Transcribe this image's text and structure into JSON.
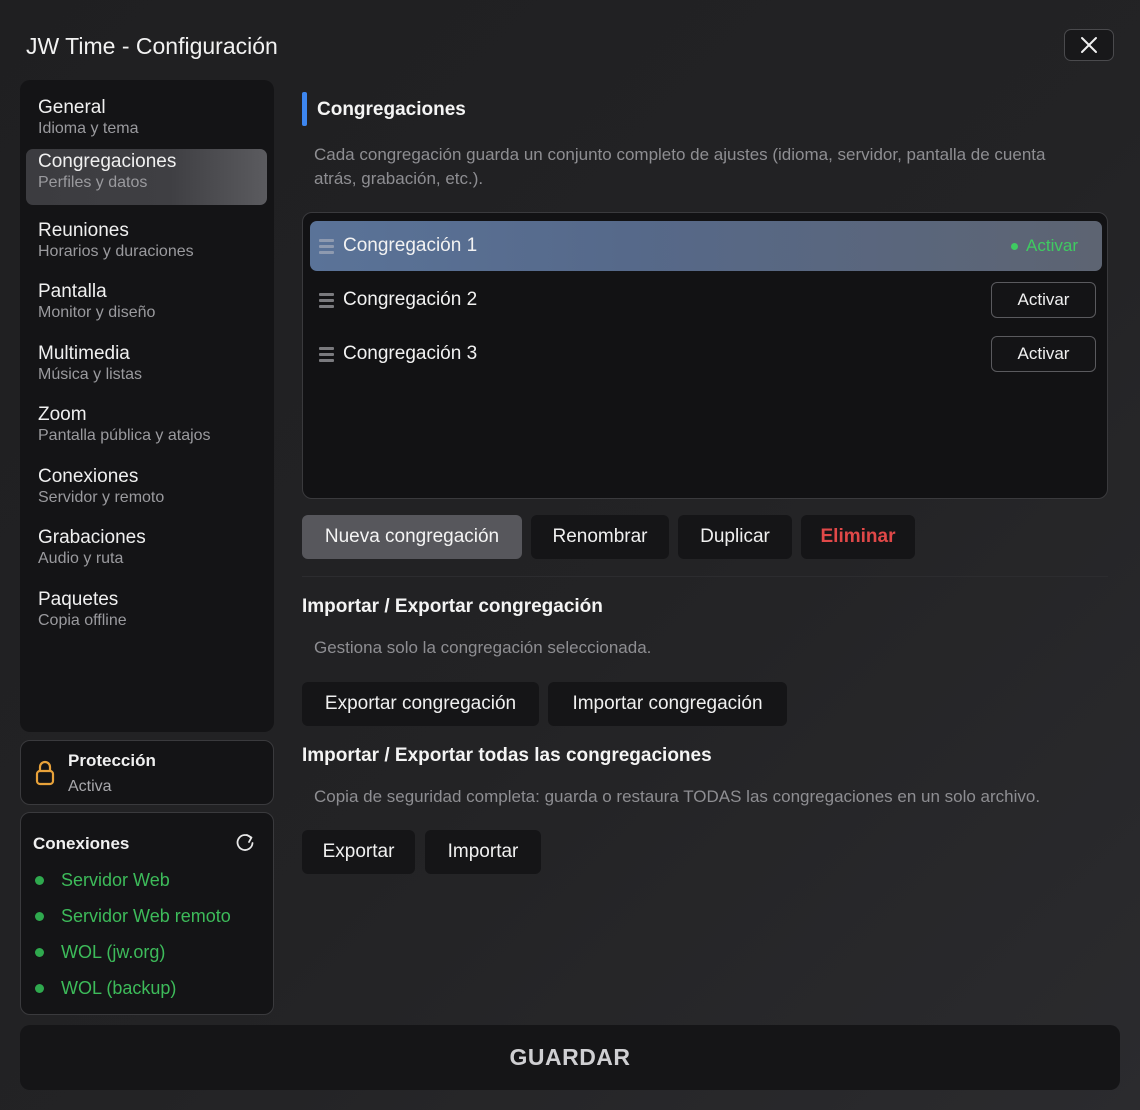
{
  "window": {
    "title": "JW Time - Configuración"
  },
  "sidebar": {
    "items": [
      {
        "label": "General",
        "sub": "Idioma y tema"
      },
      {
        "label": "Congregaciones",
        "sub": "Perfiles y datos"
      },
      {
        "label": "Reuniones",
        "sub": "Horarios y duraciones"
      },
      {
        "label": "Pantalla",
        "sub": "Monitor y diseño"
      },
      {
        "label": "Multimedia",
        "sub": "Música y listas"
      },
      {
        "label": "Zoom",
        "sub": "Pantalla pública y atajos"
      },
      {
        "label": "Conexiones",
        "sub": "Servidor y remoto"
      },
      {
        "label": "Grabaciones",
        "sub": "Audio y ruta"
      },
      {
        "label": "Paquetes",
        "sub": "Copia offline"
      }
    ],
    "active_index": 1
  },
  "protection": {
    "title": "Protección",
    "state": "Activa",
    "icon": "lock-icon"
  },
  "connections": {
    "title": "Conexiones",
    "status_color": "#3dbb5a",
    "items": [
      "Servidor Web",
      "Servidor Web remoto",
      "WOL (jw.org)",
      "WOL (backup)"
    ]
  },
  "main": {
    "section_title": "Congregaciones",
    "description_line1": "Cada congregación guarda un conjunto completo de ajustes (idioma, servidor, pantalla de cuenta",
    "description_line2": "atrás, grabación, etc.).",
    "congregations": [
      {
        "name": "Congregación 1",
        "action": "Activar",
        "active": true
      },
      {
        "name": "Congregación 2",
        "action": "Activar",
        "active": false
      },
      {
        "name": "Congregación 3",
        "action": "Activar",
        "active": false
      }
    ],
    "actions": {
      "new": "Nueva congregación",
      "rename": "Renombrar",
      "duplicate": "Duplicar",
      "delete": "Eliminar"
    },
    "single_io": {
      "title": "Importar / Exportar congregación",
      "description": "Gestiona solo la congregación seleccionada.",
      "export": "Exportar congregación",
      "import": "Importar congregación"
    },
    "all_io": {
      "title": "Importar / Exportar todas las congregaciones",
      "description": "Copia de seguridad completa: guarda o restaura TODAS las congregaciones en un solo archivo.",
      "export": "Exportar",
      "import": "Importar"
    }
  },
  "footer": {
    "save_label": "GUARDAR"
  },
  "colors": {
    "accent": "#3d86f0",
    "danger": "#e04848",
    "active_green": "#3fcb61"
  }
}
